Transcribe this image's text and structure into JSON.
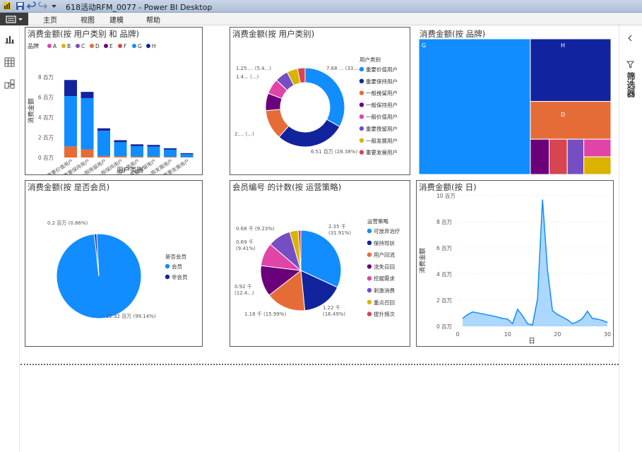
{
  "app": {
    "title": "618活动RFM_0077 - Power BI Desktop",
    "ribbon_tabs": [
      "主页",
      "视图",
      "建模",
      "帮助"
    ],
    "filter_pane_label": "筛选器"
  },
  "colors": {
    "blue": "#118DFF",
    "navy": "#12239E",
    "orange": "#E66C37",
    "purple": "#6B007B",
    "pink": "#E044A7",
    "violet": "#744EC2",
    "yellow": "#D9B300",
    "red": "#D64550"
  },
  "visuals": {
    "bar": {
      "title": "消费金额(按 用户类别 和 品牌)",
      "legend_title": "品牌",
      "legend": [
        "A",
        "B",
        "C",
        "D",
        "E",
        "F",
        "G",
        "H"
      ],
      "ylabel": "消费金额",
      "xlabel": "用户类别",
      "yticks": [
        "8 百万",
        "6 百万",
        "4 百万",
        "2 百万",
        "0 百万"
      ]
    },
    "donut": {
      "title": "消费金额(按 用户类别)",
      "legend_title": "用户类别",
      "legend": [
        "重要价值用户",
        "重要保持用户",
        "一般挽留用户",
        "一般保持用户",
        "一般价值用户",
        "重要挽留用户",
        "一般发展用户",
        "重要发展用户"
      ],
      "labels": [
        "7.68 ... (33....",
        "6.51 百万 (28.38%)",
        "2.... (...)",
        "1.4... (...)",
        "1.25 ... (5.4...)"
      ]
    },
    "treemap": {
      "title": "消费金额(按 品牌)",
      "labels": [
        "G",
        "H",
        "D"
      ]
    },
    "pie_member": {
      "title": "消费金额(按 是否会员)",
      "legend_title": "是否会员",
      "legend": [
        "会员",
        "非会员"
      ],
      "labels": [
        "0.2 百万 (0.86%)",
        "22.92 百万 (99.14%)"
      ]
    },
    "pie_strategy": {
      "title": "会员编号 的计数(按 运营策略)",
      "legend_title": "运营策略",
      "legend": [
        "可放弃治疗",
        "保持现状",
        "用户回流",
        "流失召回",
        "挖掘需求",
        "刺激消费",
        "重点召回",
        "提升频次"
      ],
      "labels": [
        "2.35 千",
        "(31.91%)",
        "1.22 千",
        "(16.49%)",
        "1.18 千 (15.99%)",
        "0.92 千",
        "(12.4...)",
        "0.69 千",
        "(9.41%)",
        "0.68 千 (9.23%)"
      ]
    },
    "area": {
      "title": "消费金额(按 日)",
      "ylabel": "消费金额",
      "xlabel": "日",
      "yticks": [
        "10 百万",
        "8 百万",
        "6 百万",
        "4 百万",
        "2 百万",
        "0 百万"
      ],
      "xticks": [
        "0",
        "10",
        "20",
        "30"
      ]
    }
  },
  "chart_data": [
    {
      "type": "bar",
      "title": "消费金额(按 用户类别 和 品牌)",
      "xlabel": "用户类别",
      "ylabel": "消费金额",
      "ylim": [
        0,
        8
      ],
      "unit": "百万",
      "categories": [
        "重要价值用户",
        "重要保持用户",
        "一般挽留用户",
        "一般保持用户",
        "一般价值用户",
        "重要挽留用户",
        "一般发展用户",
        "重要发展用户"
      ],
      "series": [
        {
          "name": "D",
          "color": "#E66C37",
          "values": [
            1.1,
            0.8,
            0.15,
            0.12,
            0.08,
            0.08,
            0.06,
            0.03
          ]
        },
        {
          "name": "G",
          "color": "#118DFF",
          "values": [
            5.0,
            5.1,
            2.5,
            1.4,
            1.05,
            1.0,
            0.72,
            0.32
          ]
        },
        {
          "name": "H",
          "color": "#12239E",
          "values": [
            1.6,
            0.62,
            0.25,
            0.2,
            0.18,
            0.17,
            0.14,
            0.08
          ]
        }
      ]
    },
    {
      "type": "pie",
      "variant": "donut",
      "title": "消费金额(按 用户类别)",
      "categories": [
        "重要价值用户",
        "重要保持用户",
        "一般挽留用户",
        "一般保持用户",
        "一般价值用户",
        "重要挽留用户",
        "一般发展用户",
        "重要发展用户"
      ],
      "values": [
        33.1,
        28.38,
        12.2,
        7.1,
        6.3,
        5.4,
        4.4,
        3.1
      ],
      "colors": [
        "#118DFF",
        "#12239E",
        "#E66C37",
        "#6B007B",
        "#E044A7",
        "#744EC2",
        "#D9B300",
        "#D64550"
      ]
    },
    {
      "type": "treemap",
      "title": "消费金额(按 品牌)",
      "categories": [
        "G",
        "H",
        "D",
        "E",
        "F",
        "C",
        "A",
        "B"
      ],
      "values": [
        57,
        19,
        11.5,
        2.5,
        2.4,
        2.2,
        2.0,
        1.6
      ],
      "colors": [
        "#118DFF",
        "#12239E",
        "#E66C37",
        "#6B007B",
        "#D64550",
        "#744EC2",
        "#E044A7",
        "#D9B300"
      ]
    },
    {
      "type": "pie",
      "title": "消费金额(按 是否会员)",
      "categories": [
        "会员",
        "非会员"
      ],
      "values": [
        22.92,
        0.2
      ],
      "colors": [
        "#118DFF",
        "#12239E"
      ]
    },
    {
      "type": "pie",
      "title": "会员编号 的计数(按 运营策略)",
      "categories": [
        "可放弃治疗",
        "保持现状",
        "用户回流",
        "流失召回",
        "挖掘需求",
        "刺激消费",
        "重点召回",
        "提升频次"
      ],
      "values": [
        2.35,
        1.22,
        1.18,
        0.92,
        0.69,
        0.68,
        0.25,
        0.08
      ],
      "colors": [
        "#118DFF",
        "#12239E",
        "#E66C37",
        "#6B007B",
        "#E044A7",
        "#744EC2",
        "#D9B300",
        "#D64550"
      ]
    },
    {
      "type": "area",
      "title": "消费金额(按 日)",
      "xlabel": "日",
      "ylabel": "消费金额",
      "ylim": [
        0,
        10
      ],
      "xlim": [
        0,
        30
      ],
      "x": [
        1,
        2,
        3,
        5,
        7,
        9,
        10,
        11,
        12,
        13,
        14,
        15,
        16,
        17,
        18,
        19,
        20,
        22,
        23,
        24,
        25,
        26,
        27,
        28,
        29,
        30
      ],
      "y": [
        0.6,
        0.9,
        1.1,
        0.95,
        0.8,
        0.6,
        0.55,
        0.2,
        1.3,
        0.8,
        0.2,
        0.1,
        2.1,
        9.7,
        4.3,
        1.2,
        0.9,
        0.5,
        0.2,
        0.35,
        0.6,
        1.15,
        0.6,
        0.55,
        0.45,
        0.3
      ]
    }
  ]
}
